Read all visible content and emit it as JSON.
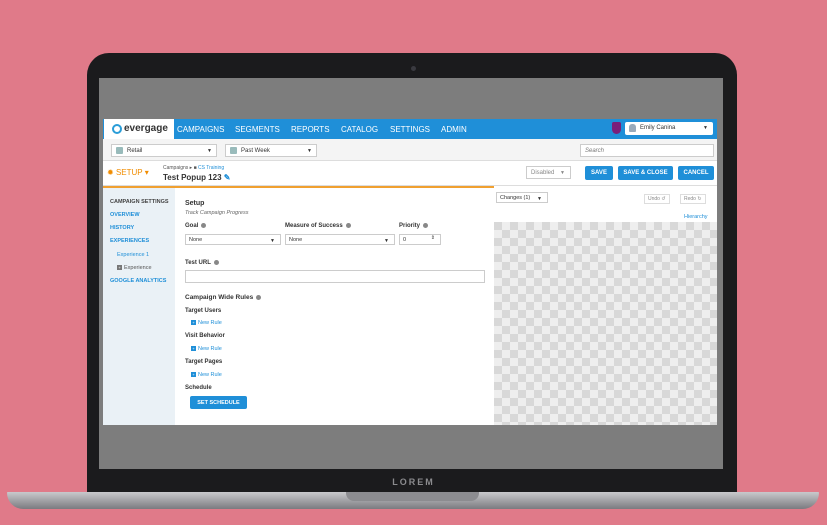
{
  "device": {
    "brand_text": "LOREM"
  },
  "nav": {
    "logo": "evergage",
    "items": [
      "CAMPAIGNS",
      "SEGMENTS",
      "REPORTS",
      "CATALOG",
      "SETTINGS",
      "ADMIN"
    ],
    "user": "Emily Canina"
  },
  "filters": {
    "site": "Retail",
    "range": "Past Week",
    "search_placeholder": "Search"
  },
  "setupbar": {
    "setup_label": "SETUP",
    "breadcrumb_root": "Campaigns",
    "breadcrumb_folder": "CS Training",
    "title": "Test Popup 123",
    "status": "Disabled",
    "save": "SAVE",
    "save_close": "SAVE & CLOSE",
    "cancel": "CANCEL"
  },
  "leftnav": {
    "heading": "CAMPAIGN SETTINGS",
    "overview": "OVERVIEW",
    "history": "HISTORY",
    "experiences": "EXPERIENCES",
    "experience1": "Experience 1",
    "add_experience": "Experience",
    "google": "GOOGLE ANALYTICS"
  },
  "panel": {
    "setup_title": "Setup",
    "track": "Track Campaign Progress",
    "goal_label": "Goal",
    "goal_value": "None",
    "measure_label": "Measure of Success",
    "measure_value": "None",
    "priority_label": "Priority",
    "priority_value": "0",
    "test_url_label": "Test URL",
    "rules_title": "Campaign Wide Rules",
    "target_users": "Target Users",
    "visit_behavior": "Visit Behavior",
    "target_pages": "Target Pages",
    "new_rule": "New Rule",
    "schedule": "Schedule",
    "set_schedule": "SET SCHEDULE"
  },
  "right": {
    "changes": "Changes (1)",
    "undo": "Undo",
    "redo": "Redo",
    "hierarchy": "Hierarchy"
  },
  "colors": {
    "accent": "#1f8fd8",
    "setup": "#f08c00",
    "background": "#e07a89"
  }
}
